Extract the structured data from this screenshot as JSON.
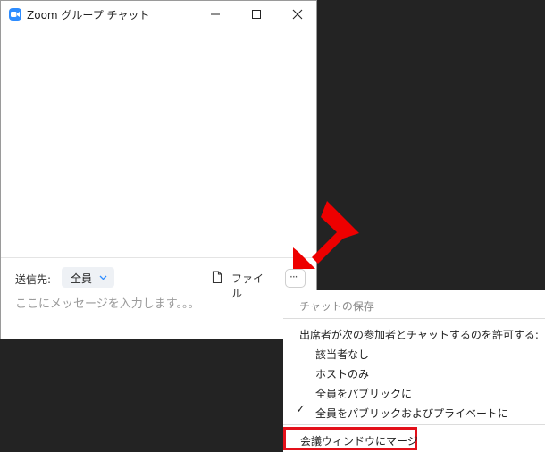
{
  "window": {
    "title": "Zoom グループ チャット"
  },
  "composer": {
    "to_label": "送信先:",
    "recipient": "全員",
    "file_label": "ファイル",
    "more_label": "···",
    "message_placeholder": "ここにメッセージを入力します。。。"
  },
  "menu": {
    "save_chat": "チャットの保存",
    "permission_heading": "出席者が次の参加者とチャットするのを許可する:",
    "options": [
      {
        "label": "該当者なし",
        "checked": false
      },
      {
        "label": "ホストのみ",
        "checked": false
      },
      {
        "label": "全員をパブリックに",
        "checked": false
      },
      {
        "label": "全員をパブリックおよびプライベートに",
        "checked": true
      }
    ],
    "check_mark": "✓",
    "merge": "会議ウィンドウにマージ"
  },
  "colors": {
    "accent": "#2d8cff",
    "highlight": "#e3101a",
    "background": "#232323"
  }
}
